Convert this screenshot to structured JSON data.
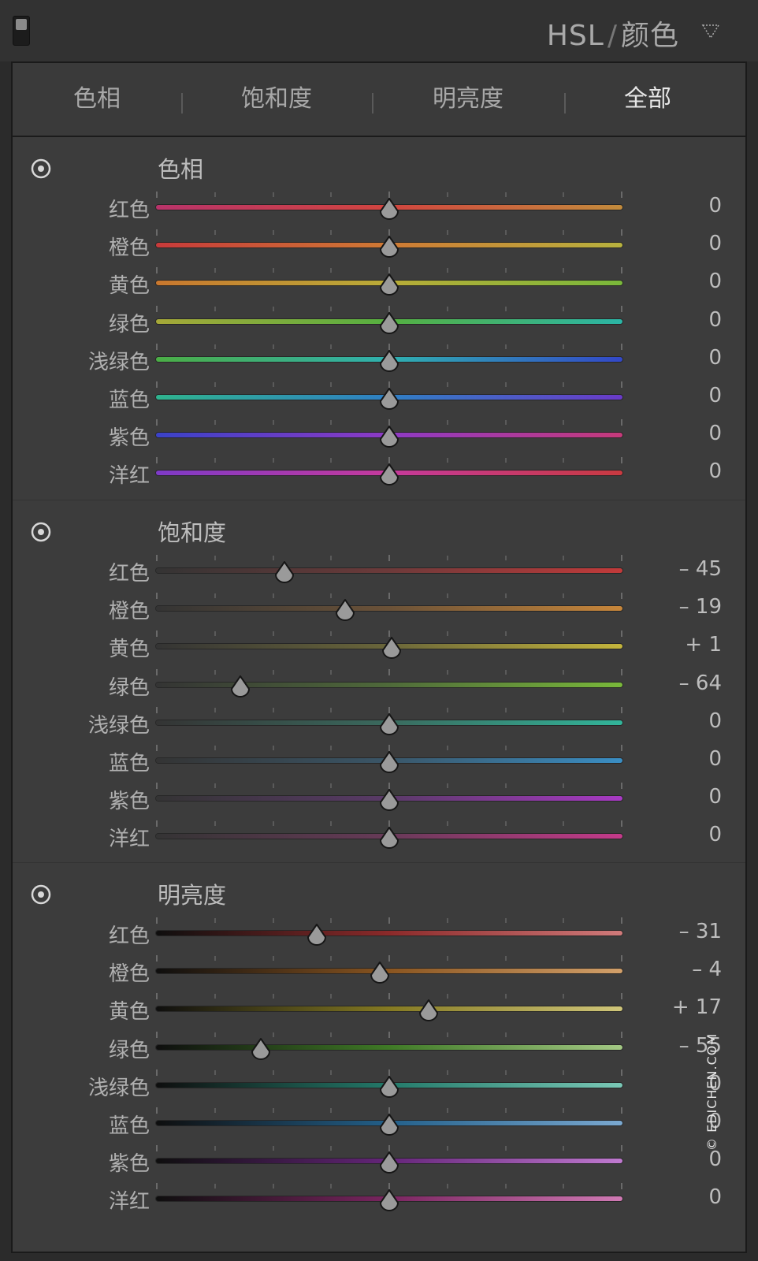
{
  "header": {
    "title": "HSL",
    "separator": "/",
    "subtitle": "颜色"
  },
  "tabs": [
    {
      "label": "色相",
      "active": false
    },
    {
      "label": "饱和度",
      "active": false
    },
    {
      "label": "明亮度",
      "active": false
    },
    {
      "label": "全部",
      "active": true
    }
  ],
  "sections": [
    {
      "id": "hue",
      "title": "色相",
      "rows": [
        {
          "label": "红色",
          "value": "0",
          "level": 0,
          "gradient": [
            "#b8336a",
            "#d1453f",
            "#c28b3c"
          ]
        },
        {
          "label": "橙色",
          "value": "0",
          "level": 0,
          "gradient": [
            "#c83a3a",
            "#cf7a34",
            "#b7b23e"
          ]
        },
        {
          "label": "黄色",
          "value": "0",
          "level": 0,
          "gradient": [
            "#c9772e",
            "#b9ac38",
            "#79b83a"
          ]
        },
        {
          "label": "绿色",
          "value": "0",
          "level": 0,
          "gradient": [
            "#a6a838",
            "#55b041",
            "#2bb5a6"
          ]
        },
        {
          "label": "浅绿色",
          "value": "0",
          "level": 0,
          "gradient": [
            "#4bae45",
            "#2fb0b0",
            "#3348c8"
          ]
        },
        {
          "label": "蓝色",
          "value": "0",
          "level": 0,
          "gradient": [
            "#2fb48e",
            "#2f7fc4",
            "#6a3ac8"
          ]
        },
        {
          "label": "紫色",
          "value": "0",
          "level": 0,
          "gradient": [
            "#3a42c8",
            "#8e3ac5",
            "#c63a7a"
          ]
        },
        {
          "label": "洋红",
          "value": "0",
          "level": 0,
          "gradient": [
            "#7e3ac8",
            "#c63a9c",
            "#c93a40"
          ]
        }
      ]
    },
    {
      "id": "saturation",
      "title": "饱和度",
      "rows": [
        {
          "label": "红色",
          "value": "– 45",
          "level": -45,
          "gradient": [
            "#343434",
            "#6d3a3a",
            "#c23a3a"
          ]
        },
        {
          "label": "橙色",
          "value": "– 19",
          "level": -19,
          "gradient": [
            "#343434",
            "#6b5238",
            "#c7863a"
          ]
        },
        {
          "label": "黄色",
          "value": "+ 1",
          "level": 1,
          "gradient": [
            "#343434",
            "#6a663a",
            "#c4b53c"
          ]
        },
        {
          "label": "绿色",
          "value": "– 64",
          "level": -64,
          "gradient": [
            "#343434",
            "#4f6a3a",
            "#79b83a"
          ]
        },
        {
          "label": "浅绿色",
          "value": "0",
          "level": 0,
          "gradient": [
            "#343434",
            "#3a6a5e",
            "#32b59a"
          ]
        },
        {
          "label": "蓝色",
          "value": "0",
          "level": 0,
          "gradient": [
            "#343434",
            "#3a5668",
            "#3a8ec4"
          ]
        },
        {
          "label": "紫色",
          "value": "0",
          "level": 0,
          "gradient": [
            "#343434",
            "#5a3a68",
            "#a83ac4"
          ]
        },
        {
          "label": "洋红",
          "value": "0",
          "level": 0,
          "gradient": [
            "#343434",
            "#683a58",
            "#c43a8a"
          ]
        }
      ]
    },
    {
      "id": "luminance",
      "title": "明亮度",
      "rows": [
        {
          "label": "红色",
          "value": "– 31",
          "level": -31,
          "gradient": [
            "#0e0e0e",
            "#8c2a2a",
            "#d07a7a"
          ]
        },
        {
          "label": "橙色",
          "value": "– 4",
          "level": -4,
          "gradient": [
            "#0e0e0e",
            "#8a5520",
            "#d2a06a"
          ]
        },
        {
          "label": "黄色",
          "value": "+ 17",
          "level": 17,
          "gradient": [
            "#0e0e0e",
            "#857a22",
            "#d0c67a"
          ]
        },
        {
          "label": "绿色",
          "value": "– 55",
          "level": -55,
          "gradient": [
            "#0e0e0e",
            "#3f7a26",
            "#a3c884"
          ]
        },
        {
          "label": "浅绿色",
          "value": "0",
          "level": 0,
          "gradient": [
            "#0e0e0e",
            "#237a6a",
            "#7ac8b6"
          ]
        },
        {
          "label": "蓝色",
          "value": "0",
          "level": 0,
          "gradient": [
            "#0e0e0e",
            "#23608a",
            "#7aa8d0"
          ]
        },
        {
          "label": "紫色",
          "value": "0",
          "level": 0,
          "gradient": [
            "#0e0e0e",
            "#65257a",
            "#c07ad0"
          ]
        },
        {
          "label": "洋红",
          "value": "0",
          "level": 0,
          "gradient": [
            "#0e0e0e",
            "#7a2560",
            "#d07ab4"
          ]
        }
      ]
    }
  ],
  "watermark": "© EDICHEN.COM",
  "icons": {
    "target": "target-adjust-icon",
    "menu": "panel-menu-icon"
  }
}
